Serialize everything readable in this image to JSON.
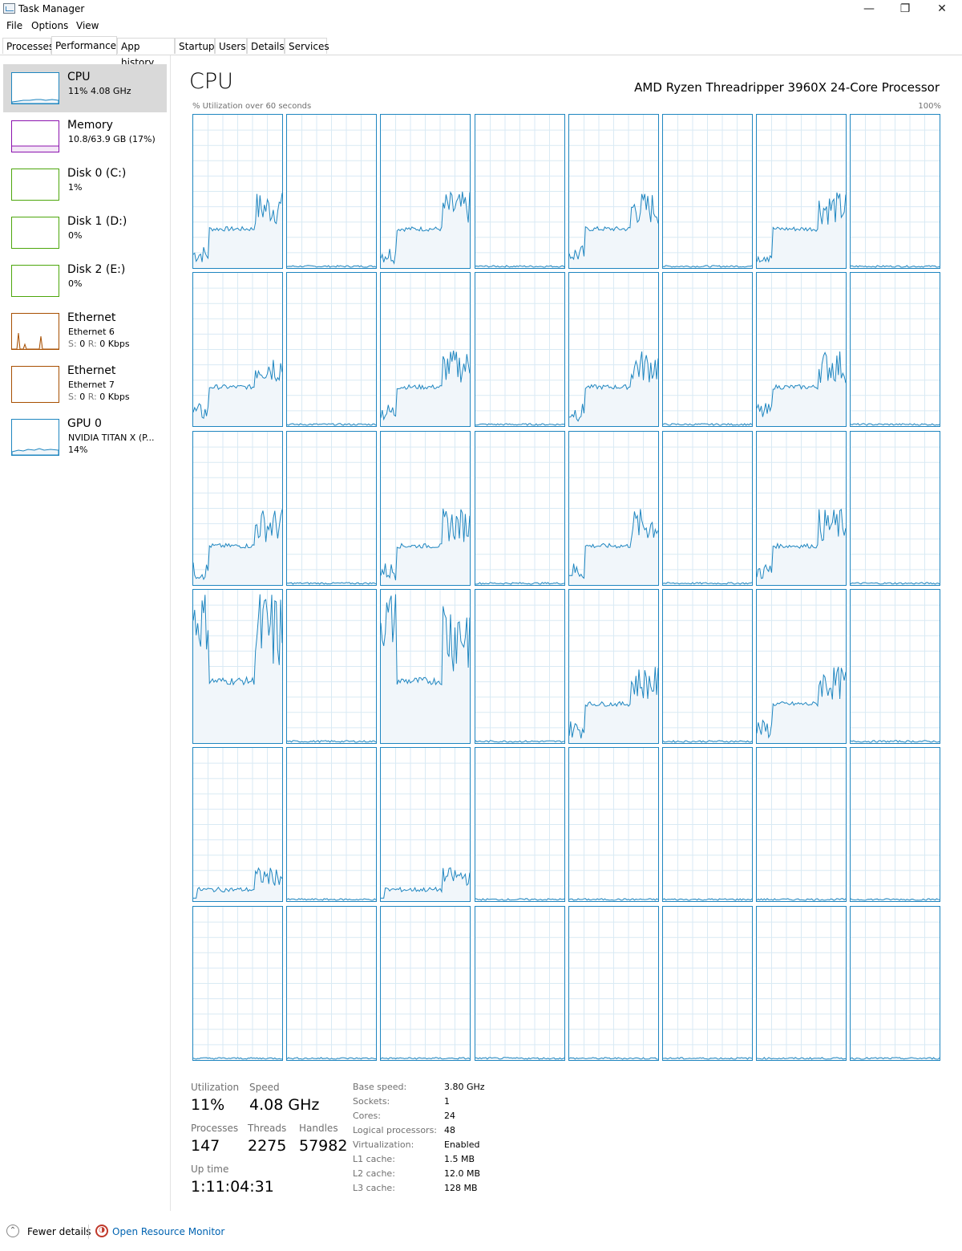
{
  "window": {
    "title": "Task Manager"
  },
  "menu": [
    "File",
    "Options",
    "View"
  ],
  "tabs": [
    {
      "label": "Processes"
    },
    {
      "label": "Performance"
    },
    {
      "label": "App history"
    },
    {
      "label": "Startup"
    },
    {
      "label": "Users"
    },
    {
      "label": "Details"
    },
    {
      "label": "Services"
    }
  ],
  "sidebar": {
    "items": [
      {
        "name": "CPU",
        "line2": "11%  4.08 GHz",
        "color": "#1f86c0",
        "selected": true
      },
      {
        "name": "Memory",
        "line2": "10.8/63.9 GB (17%)",
        "color": "#8b12ae"
      },
      {
        "name": "Disk 0 (C:)",
        "line2": "1%",
        "color": "#4da60c"
      },
      {
        "name": "Disk 1 (D:)",
        "line2": "0%",
        "color": "#4da60c"
      },
      {
        "name": "Disk 2 (E:)",
        "line2": "0%",
        "color": "#4da60c"
      },
      {
        "name": "Ethernet",
        "line2": "Ethernet 6",
        "line3_s": "S:",
        "line3_sv": "0",
        "line3_r": "R:",
        "line3_rv": "0 Kbps",
        "color": "#a74f01"
      },
      {
        "name": "Ethernet",
        "line2": "Ethernet 7",
        "line3_s": "S:",
        "line3_sv": "0",
        "line3_r": "R:",
        "line3_rv": "0 Kbps",
        "color": "#a74f01"
      },
      {
        "name": "GPU 0",
        "line2": "NVIDIA TITAN X (P...",
        "line3": "14%",
        "color": "#1f86c0"
      }
    ]
  },
  "main": {
    "title": "CPU",
    "processor": "AMD Ryzen Threadripper 3960X 24-Core Processor",
    "util_label": "% Utilization over 60 seconds",
    "util_max": "100%",
    "graph_color": "#1f86c0",
    "logical_processor_activity": [
      "mid",
      "idle",
      "mid",
      "idle",
      "mid",
      "idle",
      "mid",
      "idle",
      "mid",
      "idle",
      "mid",
      "idle",
      "mid",
      "idle",
      "mid",
      "idle",
      "mid",
      "idle",
      "mid",
      "idle",
      "mid",
      "idle",
      "mid",
      "idle",
      "full",
      "idle",
      "full",
      "idle",
      "mid",
      "idle",
      "mid",
      "idle",
      "low",
      "idle",
      "low",
      "idle",
      "idle",
      "idle",
      "idle",
      "idle",
      "idle",
      "idle",
      "idle",
      "idle",
      "idle",
      "idle",
      "idle",
      "idle"
    ]
  },
  "stats": {
    "utilization_label": "Utilization",
    "utilization": "11%",
    "speed_label": "Speed",
    "speed": "4.08 GHz",
    "processes_label": "Processes",
    "processes": "147",
    "threads_label": "Threads",
    "threads": "2275",
    "handles_label": "Handles",
    "handles": "57982",
    "uptime_label": "Up time",
    "uptime": "1:11:04:31"
  },
  "specs": [
    {
      "label": "Base speed:",
      "value": "3.80 GHz"
    },
    {
      "label": "Sockets:",
      "value": "1"
    },
    {
      "label": "Cores:",
      "value": "24"
    },
    {
      "label": "Logical processors:",
      "value": "48"
    },
    {
      "label": "Virtualization:",
      "value": "Enabled"
    },
    {
      "label": "L1 cache:",
      "value": "1.5 MB"
    },
    {
      "label": "L2 cache:",
      "value": "12.0 MB"
    },
    {
      "label": "L3 cache:",
      "value": "128 MB"
    }
  ],
  "footer": {
    "fewer_details": "Fewer details",
    "resource_monitor": "Open Resource Monitor"
  },
  "icons": {
    "minimize": "minimize-icon",
    "restore": "restore-icon",
    "close": "close-icon"
  }
}
